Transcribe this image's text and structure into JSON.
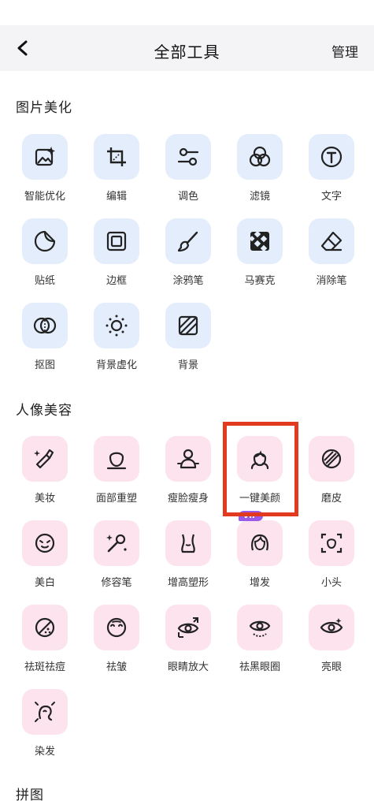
{
  "header": {
    "title": "全部工具",
    "manage_label": "管理"
  },
  "sections": {
    "photo": {
      "title": "图片美化"
    },
    "beauty": {
      "title": "人像美容"
    },
    "collage": {
      "title": "拼图"
    }
  },
  "photo_tools": [
    {
      "label": "智能优化",
      "icon": "smart-optimize-icon"
    },
    {
      "label": "编辑",
      "icon": "crop-icon"
    },
    {
      "label": "调色",
      "icon": "adjust-sliders-icon"
    },
    {
      "label": "滤镜",
      "icon": "filter-circles-icon"
    },
    {
      "label": "文字",
      "icon": "text-t-icon"
    },
    {
      "label": "贴纸",
      "icon": "sticker-icon"
    },
    {
      "label": "边框",
      "icon": "frame-icon"
    },
    {
      "label": "涂鸦笔",
      "icon": "brush-icon"
    },
    {
      "label": "马赛克",
      "icon": "mosaic-icon"
    },
    {
      "label": "消除笔",
      "icon": "eraser-icon"
    },
    {
      "label": "抠图",
      "icon": "cutout-icon"
    },
    {
      "label": "背景虚化",
      "icon": "background-blur-icon"
    },
    {
      "label": "背景",
      "icon": "background-icon"
    }
  ],
  "beauty_tools": [
    {
      "label": "美妆",
      "icon": "lipstick-icon"
    },
    {
      "label": "面部重塑",
      "icon": "face-reshape-icon"
    },
    {
      "label": "瘦脸瘦身",
      "icon": "slim-body-icon"
    },
    {
      "label": "一键美颜",
      "icon": "one-tap-beauty-icon"
    },
    {
      "label": "磨皮",
      "icon": "smooth-skin-icon"
    },
    {
      "label": "美白",
      "icon": "whitening-icon"
    },
    {
      "label": "修容笔",
      "icon": "contour-brush-icon"
    },
    {
      "label": "增高塑形",
      "icon": "body-shape-icon"
    },
    {
      "label": "增发",
      "icon": "add-hair-icon",
      "badge": "VIP"
    },
    {
      "label": "小头",
      "icon": "small-head-icon"
    },
    {
      "label": "祛斑祛痘",
      "icon": "remove-spots-icon"
    },
    {
      "label": "祛皱",
      "icon": "remove-wrinkles-icon"
    },
    {
      "label": "眼睛放大",
      "icon": "eye-enlarge-icon"
    },
    {
      "label": "祛黑眼圈",
      "icon": "remove-dark-circles-icon"
    },
    {
      "label": "亮眼",
      "icon": "bright-eyes-icon"
    },
    {
      "label": "染发",
      "icon": "hair-dye-icon"
    }
  ],
  "colors": {
    "blue_tile": "#e3edfb",
    "pink_tile": "#fce3ee",
    "highlight": "#e13a1e",
    "vip": "#9b5be8"
  }
}
